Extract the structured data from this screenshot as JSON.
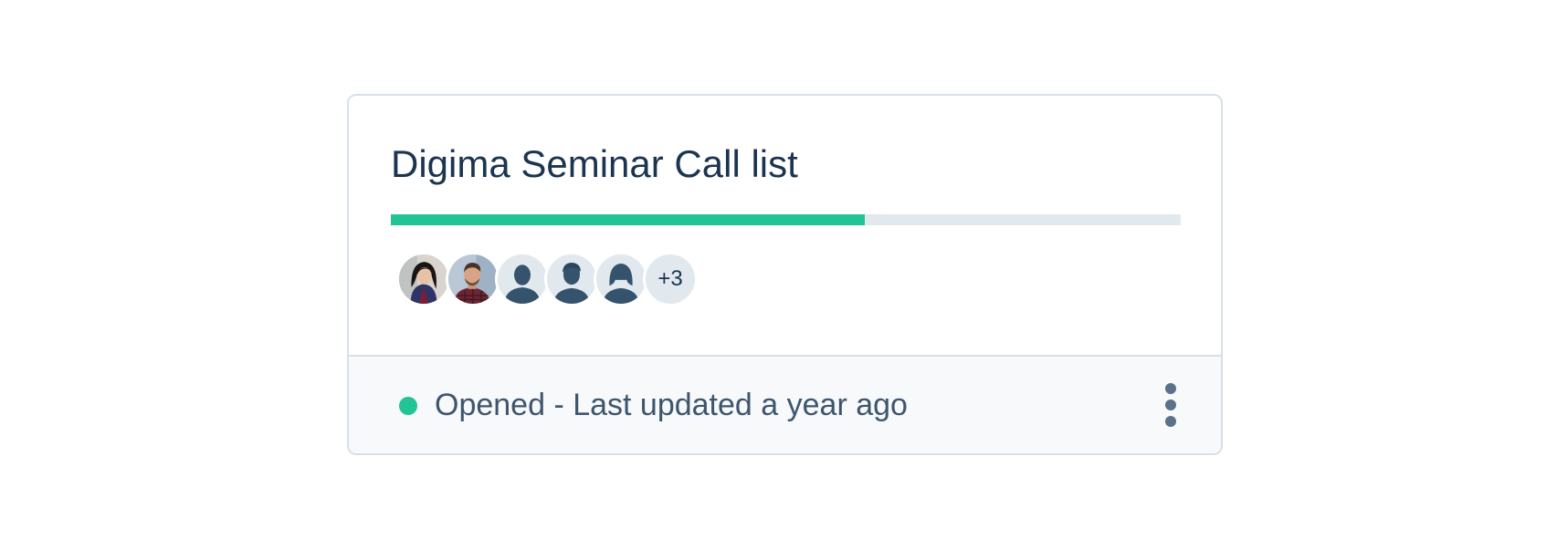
{
  "card": {
    "title": "Digima Seminar Call list",
    "progress": {
      "percent": 60,
      "fill_color": "#21c494",
      "track_color": "#e1e8ee"
    },
    "avatars": [
      {
        "type": "photo",
        "icon": "woman-photo-avatar"
      },
      {
        "type": "photo",
        "icon": "man-photo-avatar"
      },
      {
        "type": "placeholder",
        "icon": "person-silhouette-icon"
      },
      {
        "type": "placeholder",
        "icon": "man-silhouette-icon"
      },
      {
        "type": "placeholder",
        "icon": "woman-silhouette-icon"
      }
    ],
    "more_members": "+3",
    "footer": {
      "status_text": "Opened - Last updated a year ago",
      "status_color": "#21c494",
      "menu_icon": "vertical-ellipsis-icon"
    }
  }
}
